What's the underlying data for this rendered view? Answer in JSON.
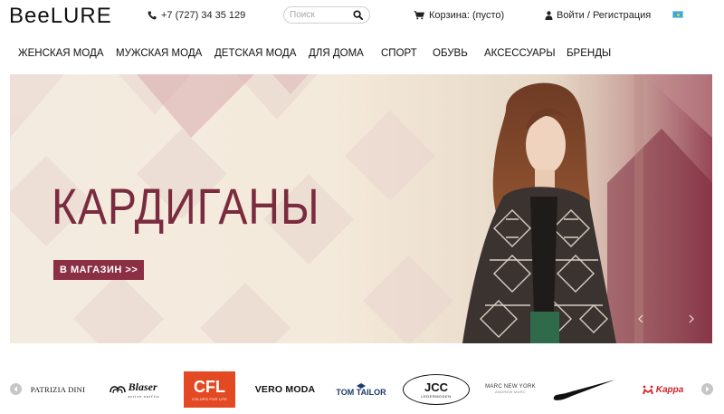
{
  "header": {
    "logo": "BeeLURE",
    "phone": "+7 (727) 34 35 129",
    "search_placeholder": "Поиск",
    "cart": "Корзина: (пусто)",
    "login": "Войти / Регистрация",
    "flag": "kz-flag-icon"
  },
  "nav": {
    "items": [
      "ЖЕНСКАЯ МОДА",
      "МУЖСКАЯ МОДА",
      "ДЕТСКАЯ МОДА",
      "ДЛЯ ДОМА",
      "СПОРТ",
      "ОБУВЬ",
      "АКСЕССУАРЫ",
      "БРЕНДЫ"
    ]
  },
  "banner": {
    "title": "КАРДИГАНЫ",
    "button": "В МАГАЗИН >>",
    "accent_color": "#8b2f44"
  },
  "brands": {
    "items": [
      {
        "name": "PATRIZIA DINI"
      },
      {
        "name": "Blaser",
        "tagline": "active outfits"
      },
      {
        "name": "CFL",
        "tagline": "COLORS FOR LIFE"
      },
      {
        "name": "VERO MODA"
      },
      {
        "name": "TOM TAILOR"
      },
      {
        "name": "JCC",
        "tagline": "LEDERMODEN"
      },
      {
        "name": "MARC NEW YORK",
        "tagline": "ANDREW MARC"
      },
      {
        "name": "nike-swoosh-logo"
      },
      {
        "name": "Kappa"
      }
    ]
  }
}
